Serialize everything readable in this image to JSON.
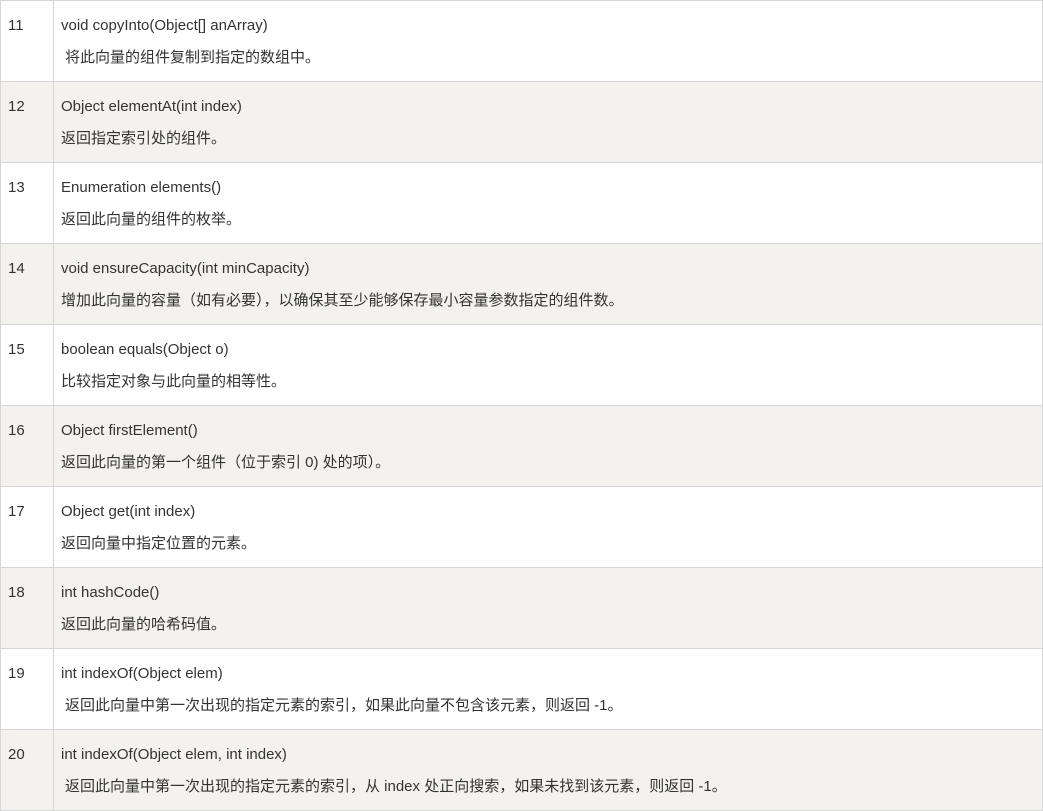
{
  "rows": [
    {
      "num": "11",
      "signature": "void copyInto(Object[] anArray)",
      "description": "将此向量的组件复制到指定的数组中。"
    },
    {
      "num": "12",
      "signature": "Object elementAt(int index)",
      "description": "返回指定索引处的组件。"
    },
    {
      "num": "13",
      "signature": "Enumeration elements()",
      "description": "返回此向量的组件的枚举。"
    },
    {
      "num": "14",
      "signature": "void ensureCapacity(int minCapacity)",
      "description": "增加此向量的容量（如有必要），以确保其至少能够保存最小容量参数指定的组件数。"
    },
    {
      "num": "15",
      "signature": "boolean equals(Object o)",
      "description": "比较指定对象与此向量的相等性。"
    },
    {
      "num": "16",
      "signature": "Object firstElement()",
      "description": "返回此向量的第一个组件（位于索引 0) 处的项）。"
    },
    {
      "num": "17",
      "signature": "Object get(int index)",
      "description": "返回向量中指定位置的元素。"
    },
    {
      "num": "18",
      "signature": "int hashCode()",
      "description": "返回此向量的哈希码值。"
    },
    {
      "num": "19",
      "signature": "int indexOf(Object elem)",
      "description": "返回此向量中第一次出现的指定元素的索引，如果此向量不包含该元素，则返回 -1。"
    },
    {
      "num": "20",
      "signature": "int indexOf(Object elem, int index)",
      "description": "返回此向量中第一次出现的指定元素的索引，从 index 处正向搜索，如果未找到该元素，则返回 -1。"
    }
  ]
}
